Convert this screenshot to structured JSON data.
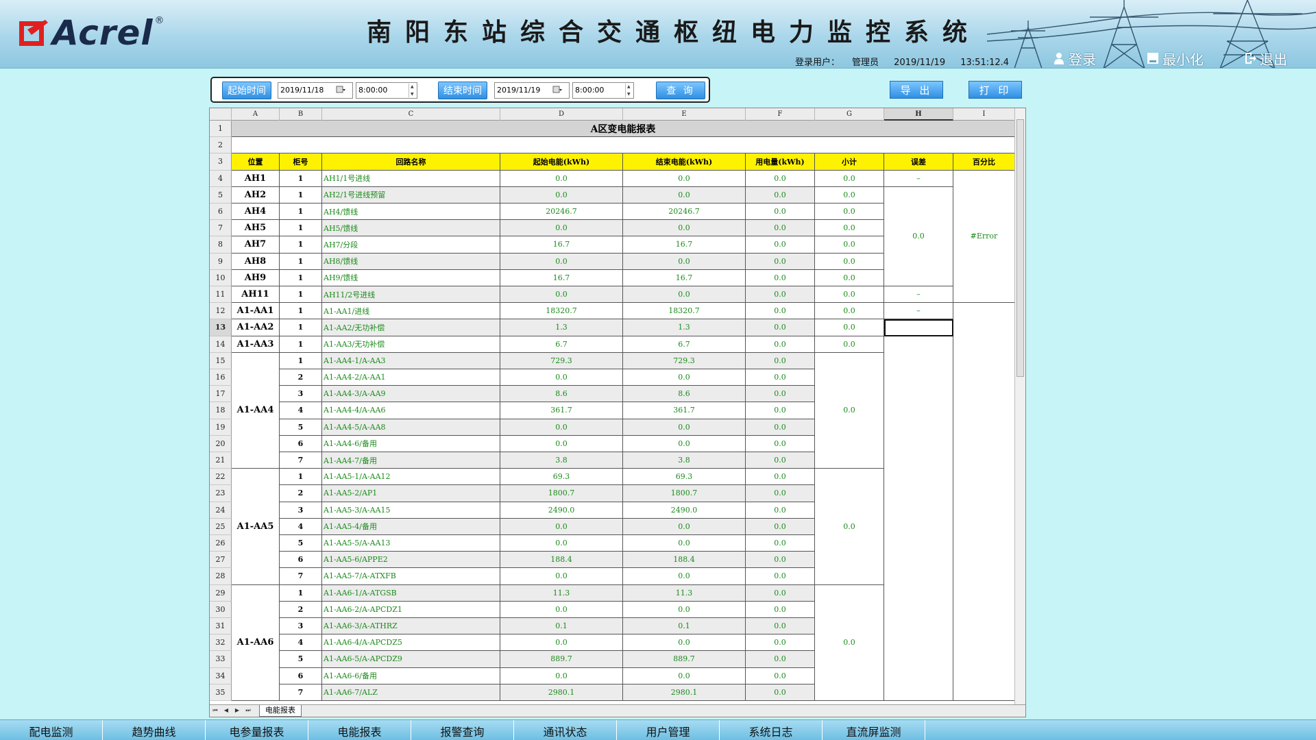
{
  "header": {
    "logo_text": "Acrel",
    "logo_reg": "®",
    "title": "南阳东站综合交通枢纽电力监控系统",
    "user_label": "登录用户：",
    "user_name": "管理员",
    "date": "2019/11/19",
    "time": "13:51:12.4",
    "buttons": {
      "login": "登录",
      "minimize": "最小化",
      "exit": "退出"
    }
  },
  "query": {
    "start_label": "起始时间",
    "start_date": "2019/11/18",
    "start_time": "8:00:00",
    "end_label": "结束时间",
    "end_date": "2019/11/19",
    "end_time": "8:00:00",
    "search": "查 询",
    "export": "导 出",
    "print": "打 印"
  },
  "sheet": {
    "columns": [
      "A",
      "B",
      "C",
      "D",
      "E",
      "F",
      "G",
      "H",
      "I"
    ],
    "selected_column": "H",
    "selected_row": 13,
    "title": "A区变电能报表",
    "headers": [
      "位置",
      "柜号",
      "回路名称",
      "起始电能(kWh)",
      "结束电能(kWh)",
      "用电量(kWh)",
      "小计",
      "误差",
      "百分比"
    ],
    "tab_name": "电能报表",
    "rows": [
      {
        "n": 4,
        "pos": "AH1",
        "cab": "1",
        "name": "AH1/1号进线",
        "d": "0.0",
        "e": "0.0",
        "f": "0.0",
        "g": "0.0",
        "h": "–"
      },
      {
        "n": 5,
        "pos": "AH2",
        "cab": "1",
        "name": "AH2/1号进线预留",
        "d": "0.0",
        "e": "0.0",
        "f": "0.0",
        "g": "0.0"
      },
      {
        "n": 6,
        "pos": "AH4",
        "cab": "1",
        "name": "AH4/馈线",
        "d": "20246.7",
        "e": "20246.7",
        "f": "0.0",
        "g": "0.0"
      },
      {
        "n": 7,
        "pos": "AH5",
        "cab": "1",
        "name": "AH5/馈线",
        "d": "0.0",
        "e": "0.0",
        "f": "0.0",
        "g": "0.0"
      },
      {
        "n": 8,
        "pos": "AH7",
        "cab": "1",
        "name": "AH7/分段",
        "d": "16.7",
        "e": "16.7",
        "f": "0.0",
        "g": "0.0"
      },
      {
        "n": 9,
        "pos": "AH8",
        "cab": "1",
        "name": "AH8/馈线",
        "d": "0.0",
        "e": "0.0",
        "f": "0.0",
        "g": "0.0"
      },
      {
        "n": 10,
        "pos": "AH9",
        "cab": "1",
        "name": "AH9/馈线",
        "d": "16.7",
        "e": "16.7",
        "f": "0.0",
        "g": "0.0"
      },
      {
        "n": 11,
        "pos": "AH11",
        "cab": "1",
        "name": "AH11/2号进线",
        "d": "0.0",
        "e": "0.0",
        "f": "0.0",
        "g": "0.0",
        "h": "–"
      },
      {
        "n": 12,
        "pos": "A1-AA1",
        "cab": "1",
        "name": "A1-AA1/进线",
        "d": "18320.7",
        "e": "18320.7",
        "f": "0.0",
        "g": "0.0",
        "h": "–"
      },
      {
        "n": 13,
        "pos": "A1-AA2",
        "cab": "1",
        "name": "A1-AA2/无功补偿",
        "d": "1.3",
        "e": "1.3",
        "f": "0.0",
        "g": "0.0"
      },
      {
        "n": 14,
        "pos": "A1-AA3",
        "cab": "1",
        "name": "A1-AA3/无功补偿",
        "d": "6.7",
        "e": "6.7",
        "f": "0.0",
        "g": "0.0"
      },
      {
        "n": 15,
        "cab": "1",
        "name": "A1-AA4-1/A-AA3",
        "d": "729.3",
        "e": "729.3",
        "f": "0.0"
      },
      {
        "n": 16,
        "cab": "2",
        "name": "A1-AA4-2/A-AA1",
        "d": "0.0",
        "e": "0.0",
        "f": "0.0"
      },
      {
        "n": 17,
        "cab": "3",
        "name": "A1-AA4-3/A-AA9",
        "d": "8.6",
        "e": "8.6",
        "f": "0.0"
      },
      {
        "n": 18,
        "cab": "4",
        "name": "A1-AA4-4/A-AA6",
        "d": "361.7",
        "e": "361.7",
        "f": "0.0"
      },
      {
        "n": 19,
        "cab": "5",
        "name": "A1-AA4-5/A-AA8",
        "d": "0.0",
        "e": "0.0",
        "f": "0.0"
      },
      {
        "n": 20,
        "cab": "6",
        "name": "A1-AA4-6/备用",
        "d": "0.0",
        "e": "0.0",
        "f": "0.0"
      },
      {
        "n": 21,
        "cab": "7",
        "name": "A1-AA4-7/备用",
        "d": "3.8",
        "e": "3.8",
        "f": "0.0"
      },
      {
        "n": 22,
        "cab": "1",
        "name": "A1-AA5-1/A-AA12",
        "d": "69.3",
        "e": "69.3",
        "f": "0.0"
      },
      {
        "n": 23,
        "cab": "2",
        "name": "A1-AA5-2/AP1",
        "d": "1800.7",
        "e": "1800.7",
        "f": "0.0"
      },
      {
        "n": 24,
        "cab": "3",
        "name": "A1-AA5-3/A-AA15",
        "d": "2490.0",
        "e": "2490.0",
        "f": "0.0"
      },
      {
        "n": 25,
        "cab": "4",
        "name": "A1-AA5-4/备用",
        "d": "0.0",
        "e": "0.0",
        "f": "0.0"
      },
      {
        "n": 26,
        "cab": "5",
        "name": "A1-AA5-5/A-AA13",
        "d": "0.0",
        "e": "0.0",
        "f": "0.0"
      },
      {
        "n": 27,
        "cab": "6",
        "name": "A1-AA5-6/APPE2",
        "d": "188.4",
        "e": "188.4",
        "f": "0.0"
      },
      {
        "n": 28,
        "cab": "7",
        "name": "A1-AA5-7/A-ATXFB",
        "d": "0.0",
        "e": "0.0",
        "f": "0.0"
      },
      {
        "n": 29,
        "cab": "1",
        "name": "A1-AA6-1/A-ATGSB",
        "d": "11.3",
        "e": "11.3",
        "f": "0.0"
      },
      {
        "n": 30,
        "cab": "2",
        "name": "A1-AA6-2/A-APCDZ1",
        "d": "0.0",
        "e": "0.0",
        "f": "0.0"
      },
      {
        "n": 31,
        "cab": "3",
        "name": "A1-AA6-3/A-ATHRZ",
        "d": "0.1",
        "e": "0.1",
        "f": "0.0"
      },
      {
        "n": 32,
        "cab": "4",
        "name": "A1-AA6-4/A-APCDZ5",
        "d": "0.0",
        "e": "0.0",
        "f": "0.0"
      },
      {
        "n": 33,
        "cab": "5",
        "name": "A1-AA6-5/A-APCDZ9",
        "d": "889.7",
        "e": "889.7",
        "f": "0.0"
      },
      {
        "n": 34,
        "cab": "6",
        "name": "A1-AA6-6/备用",
        "d": "0.0",
        "e": "0.0",
        "f": "0.0"
      },
      {
        "n": 35,
        "cab": "7",
        "name": "A1-AA6-7/ALZ",
        "d": "2980.1",
        "e": "2980.1",
        "f": "0.0"
      }
    ],
    "merged": {
      "h_5_10": "0.0",
      "i_4_11": "#Error",
      "pos_aa4": "A1-AA4",
      "g_aa4": "0.0",
      "pos_aa5": "A1-AA5",
      "g_aa5": "0.0",
      "pos_aa6": "A1-AA6",
      "g_aa6": "0.0"
    }
  },
  "bottom_nav": [
    "配电监测",
    "趋势曲线",
    "电参量报表",
    "电能报表",
    "报警查询",
    "通讯状态",
    "用户管理",
    "系统日志",
    "直流屏监测"
  ]
}
